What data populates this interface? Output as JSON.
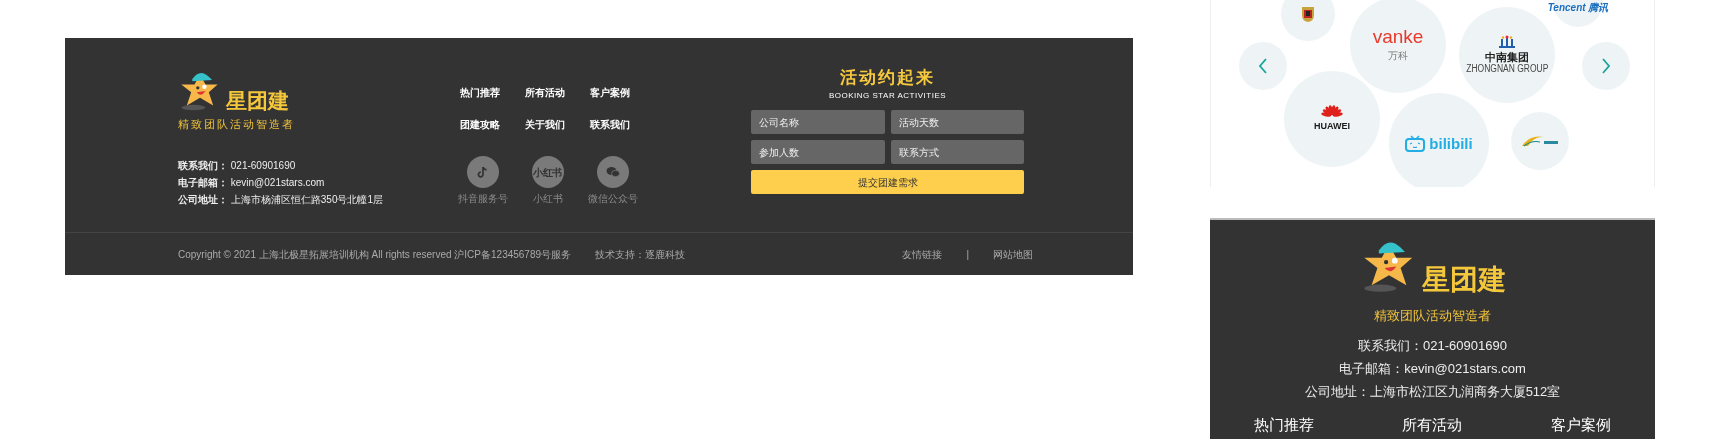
{
  "footer": {
    "brand": {
      "name": "星团建",
      "tagline": "精致团队活动智造者"
    },
    "contacts": [
      {
        "label": "联系我们：",
        "value": "021-60901690"
      },
      {
        "label": "电子邮箱：",
        "value": "kevin@021stars.com"
      },
      {
        "label": "公司地址：",
        "value": "上海市杨浦区恒仁路350号北幢1层"
      }
    ],
    "nav": [
      "热门推荐",
      "所有活动",
      "客户案例",
      "团建攻略",
      "关于我们",
      "联系我们"
    ],
    "socials": [
      {
        "kind": "douyin",
        "label": "抖音服务号"
      },
      {
        "kind": "xiaohongshu",
        "label": "小红书",
        "icon_text": "小红书"
      },
      {
        "kind": "wechat",
        "label": "微信公众号"
      }
    ],
    "form": {
      "title": "活动约起来",
      "subtitle": "BOOKING STAR ACTIVITIES",
      "fields": [
        {
          "placeholder": "公司名称"
        },
        {
          "placeholder": "活动天数"
        },
        {
          "placeholder": "参加人数"
        },
        {
          "placeholder": "联系方式"
        }
      ],
      "submit": "提交团建需求"
    },
    "copyright": "Copyright © 2021 上海北极星拓展培训机构 All rights reserved 沪ICP备123456789号服务",
    "tech_support": "技术支持：逐鹿科技",
    "links": [
      "友情链接",
      "网站地图"
    ],
    "link_separator": "|"
  },
  "mobile": {
    "partners": [
      {
        "kind": "crest"
      },
      {
        "kind": "wordmark",
        "name": "vanke",
        "subname": "万科",
        "color": "#e8392c"
      },
      {
        "kind": "group",
        "name": "中南集团",
        "subname": "ZHONGNAN GROUP",
        "color": "#1f1f1f"
      },
      {
        "kind": "wordmark",
        "name": "Tencent 腾讯",
        "color": "#1c6fbf"
      },
      {
        "kind": "prev"
      },
      {
        "kind": "next"
      },
      {
        "kind": "flower",
        "name": "HUAWEI",
        "color": "#1a1a1a"
      },
      {
        "kind": "tv",
        "name": "bilibili",
        "color": "#23ade5"
      },
      {
        "kind": "swirl"
      }
    ],
    "footer": {
      "brand": {
        "name": "星团建",
        "tagline": "精致团队活动智造者"
      },
      "contacts": [
        "联系我们：021-60901690",
        "电子邮箱：kevin@021stars.com",
        "公司地址：上海市松江区九润商务大厦512室"
      ],
      "nav": [
        "热门推荐",
        "所有活动",
        "客户案例"
      ]
    }
  }
}
